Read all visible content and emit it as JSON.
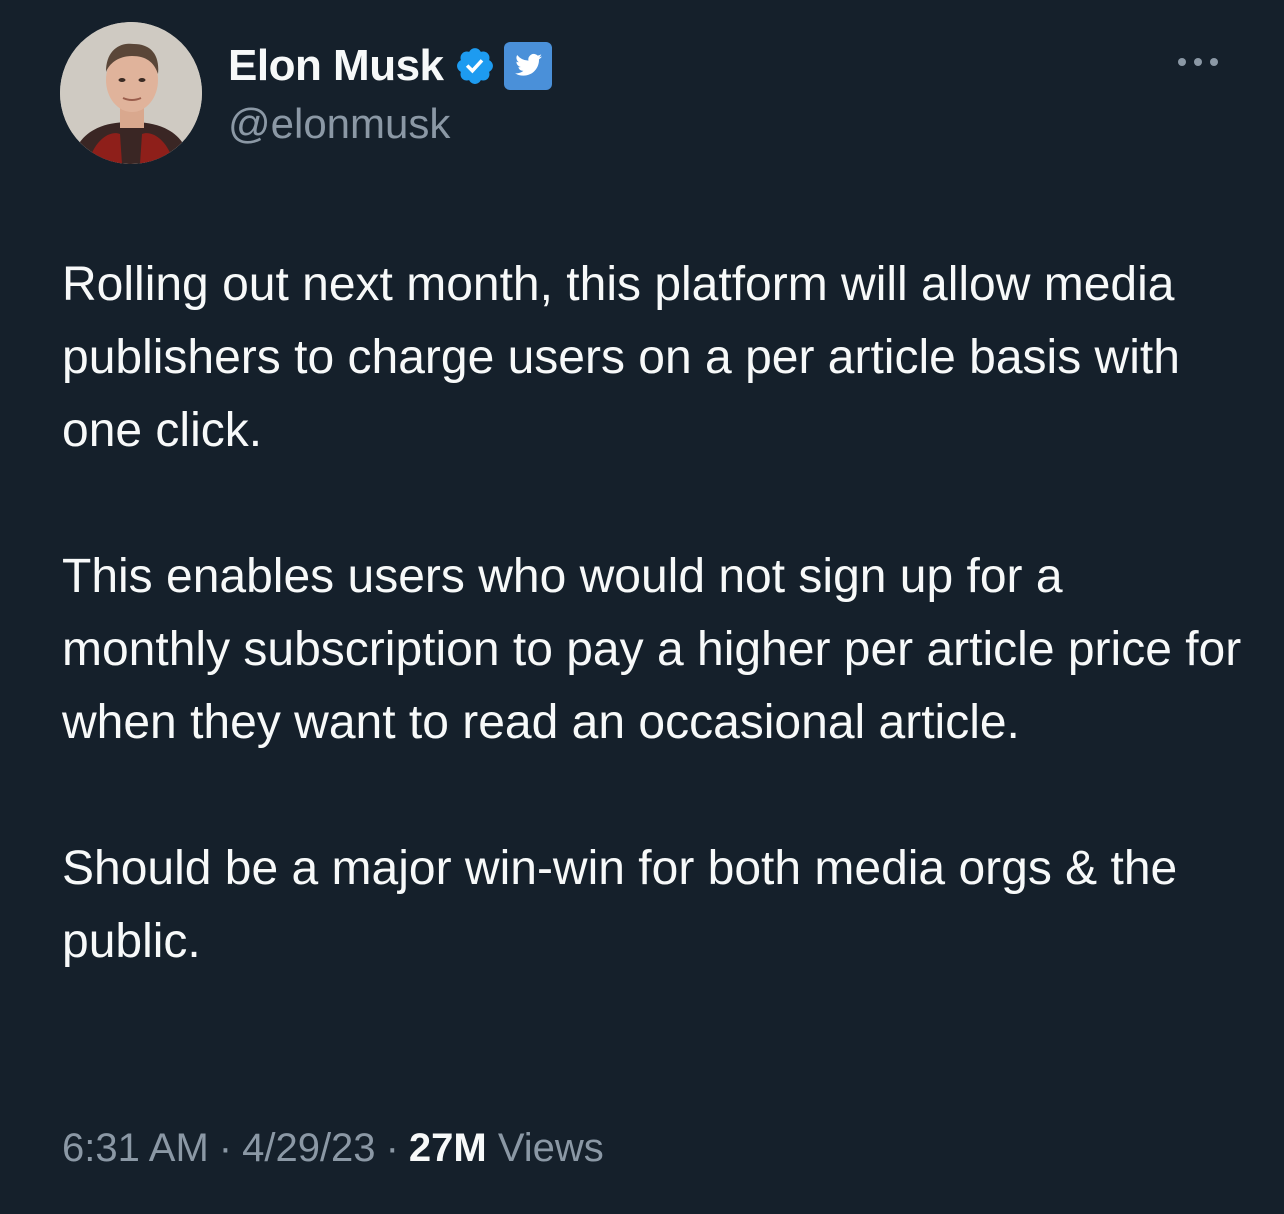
{
  "author": {
    "display_name": "Elon Musk",
    "handle": "@elonmusk",
    "verified_icon": "verified-badge-icon",
    "badge_icon": "twitter-bird-icon",
    "verified_color": "#1d9bf0"
  },
  "menu": {
    "icon": "more-options-icon"
  },
  "tweet": {
    "paragraphs": [
      "Rolling out next month, this platform will allow media publishers to charge users on a per article basis with one click.",
      "This enables users who would not sign up for a monthly subscription to pay a higher per article price for when they want to read an occasional article.",
      "Should be a major win-win for both media orgs & the public."
    ]
  },
  "meta": {
    "time": "6:31 AM",
    "separator": "·",
    "date": "4/29/23",
    "views_count": "27M",
    "views_label": "Views"
  },
  "colors": {
    "background": "#15202b",
    "text_primary": "#f7f9f9",
    "text_secondary": "#8b98a5",
    "accent": "#1d9bf0"
  }
}
